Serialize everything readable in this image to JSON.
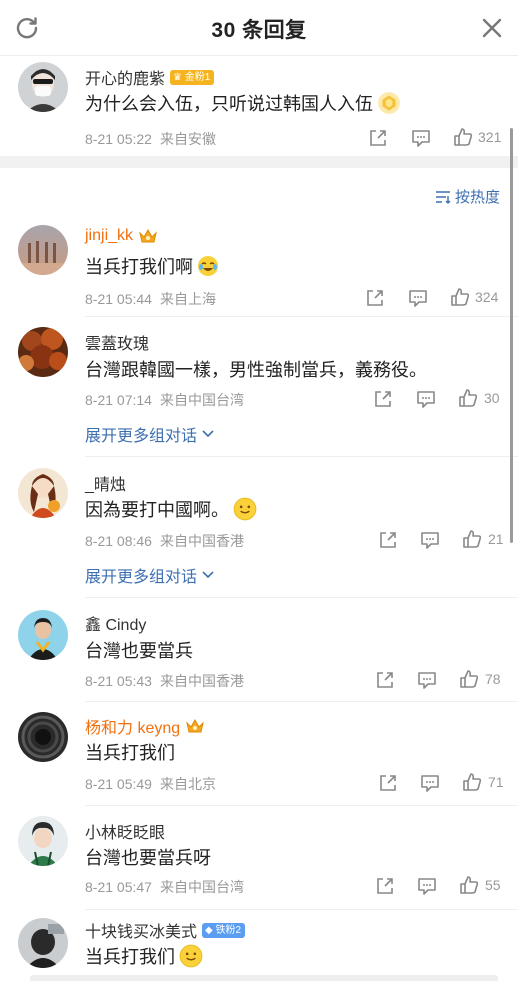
{
  "header": {
    "title": "30 条回复"
  },
  "root": {
    "name": "开心的鹿紫",
    "badge": "金粉1",
    "text": "为什么会入伍，只听说过韩国人入伍",
    "time": "8-21 05:22",
    "location": "来自安徽",
    "likes": "321"
  },
  "sort_label": "按热度",
  "comments": [
    {
      "name": "jinji_kk",
      "text": "当兵打我们啊",
      "time": "8-21 05:44",
      "location": "来自上海",
      "likes": "324"
    },
    {
      "name": "雲蓋玫瑰",
      "text": "台灣跟韓國一樣，男性強制當兵，義務役。",
      "time": "8-21 07:14",
      "location": "来自中国台湾",
      "likes": "30",
      "expand": "展开更多组对话"
    },
    {
      "name": "_晴烛",
      "text": "因為要打中國啊。",
      "time": "8-21 08:46",
      "location": "来自中国香港",
      "likes": "21",
      "expand": "展开更多组对话"
    },
    {
      "name": "鑫 Cindy",
      "text": "台灣也要當兵",
      "time": "8-21 05:43",
      "location": "来自中国香港",
      "likes": "78"
    },
    {
      "name": "杨和力 keyng",
      "text": "当兵打我们",
      "time": "8-21 05:49",
      "location": "来自北京",
      "likes": "71"
    },
    {
      "name": "小林眨眨眼",
      "text": "台灣也要當兵呀",
      "time": "8-21 05:47",
      "location": "来自中国台湾",
      "likes": "55"
    },
    {
      "name": "十块钱买冰美式",
      "badge": "铁粉2",
      "text": "当兵打我们"
    }
  ],
  "colors": {
    "vip_name": "#f2700e",
    "link": "#3e6fb2",
    "meta": "#999999"
  },
  "icons": [
    "refresh-icon",
    "close-icon",
    "share-icon",
    "comment-icon",
    "like-icon",
    "sort-icon",
    "chevron-down-icon",
    "crown-icon",
    "emoji-icon"
  ]
}
